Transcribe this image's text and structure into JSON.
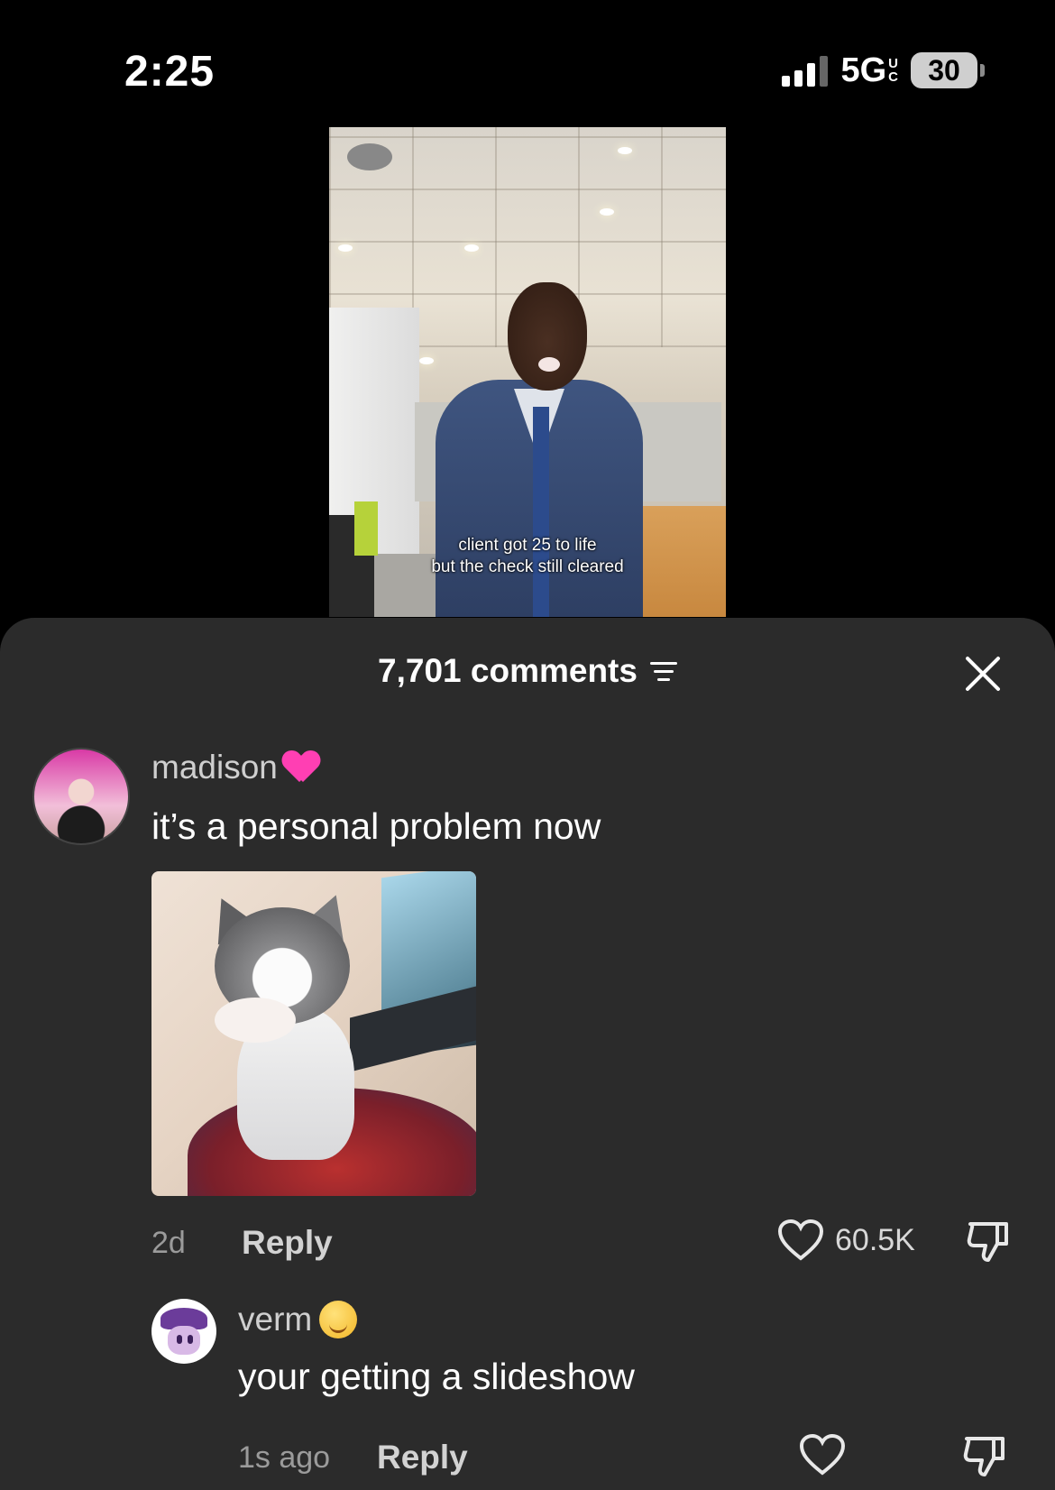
{
  "status_bar": {
    "time": "2:25",
    "network": "5G",
    "network_suffix_top": "U",
    "network_suffix_bottom": "C",
    "battery": "30"
  },
  "video": {
    "caption_line1": "client got 25 to life",
    "caption_line2": "but the check still cleared"
  },
  "comments_sheet": {
    "title": "7,701 comments",
    "comments": [
      {
        "username": "madison",
        "emoji": "pink-heart",
        "text": "it’s a personal problem now",
        "has_gif": true,
        "time": "2d",
        "reply_label": "Reply",
        "likes": "60.5K"
      },
      {
        "username": "verm",
        "emoji": "drooling-face",
        "text": "your getting a slideshow",
        "time": "1s ago",
        "reply_label": "Reply",
        "likes": ""
      }
    ]
  },
  "colors": {
    "sheet_background": "#2b2b2b",
    "heart_emoji": "#ff3fb3"
  }
}
